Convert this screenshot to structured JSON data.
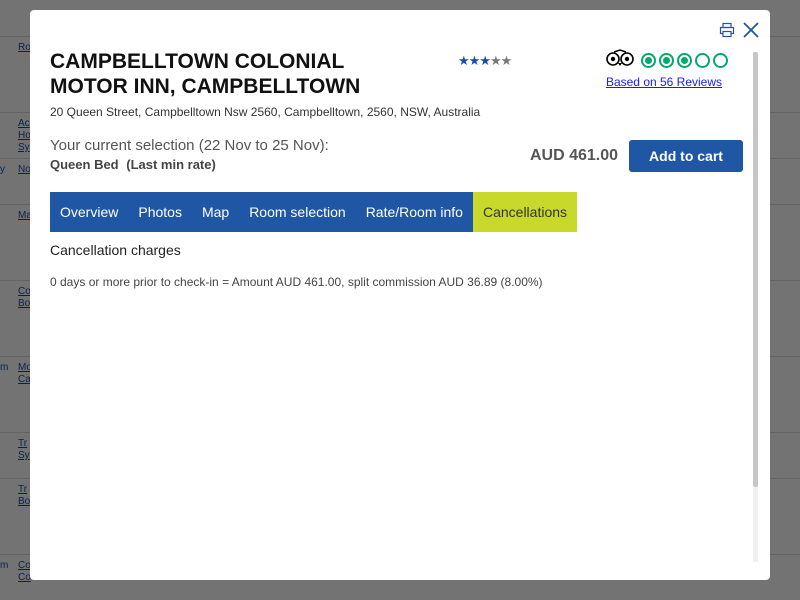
{
  "background": {
    "row_links": [
      "Ro",
      "Ac",
      "Ho",
      "Sy",
      "No",
      "Ma",
      "Co",
      "Bo",
      "Mo",
      "Ca",
      "Tr",
      "Sy",
      "Tr",
      "Bo",
      "Co",
      "Co"
    ],
    "side_labels": [
      "y",
      "m",
      "m"
    ]
  },
  "modal": {
    "print_icon": "print-icon",
    "close_icon": "close-icon",
    "hotel_name": "CAMPBELLTOWN COLONIAL MOTOR INN, CAMPBELLTOWN",
    "star_rating": 3.5,
    "address": "20 Queen Street, Campbelltown Nsw 2560, Campbelltown, 2560, NSW, Australia",
    "tripadvisor": {
      "logo_icon": "tripadvisor-owl-icon",
      "rating": 3.5,
      "reviews_label": "Based on 56 Reviews",
      "color": "#00aa6c"
    },
    "selection": {
      "label": "Your current selection (22 Nov to 25 Nov):",
      "room_type": "Queen Bed",
      "rate": "(Last min rate)",
      "price": "AUD 461.00",
      "add_to_cart": "Add to cart"
    },
    "tabs": [
      {
        "label": "Overview",
        "active": false
      },
      {
        "label": "Photos",
        "active": false
      },
      {
        "label": "Map",
        "active": false
      },
      {
        "label": "Room selection",
        "active": false
      },
      {
        "label": "Rate/Room info",
        "active": false
      },
      {
        "label": "Cancellations",
        "active": true
      }
    ],
    "cancellation": {
      "title": "Cancellation charges",
      "text": "0 days or more prior to check-in = Amount AUD 461.00, split commission AUD 36.89 (8.00%)"
    }
  },
  "colors": {
    "primary": "#1f57a4",
    "active_tab": "#c8d92b",
    "tripadvisor_green": "#00aa6c"
  }
}
